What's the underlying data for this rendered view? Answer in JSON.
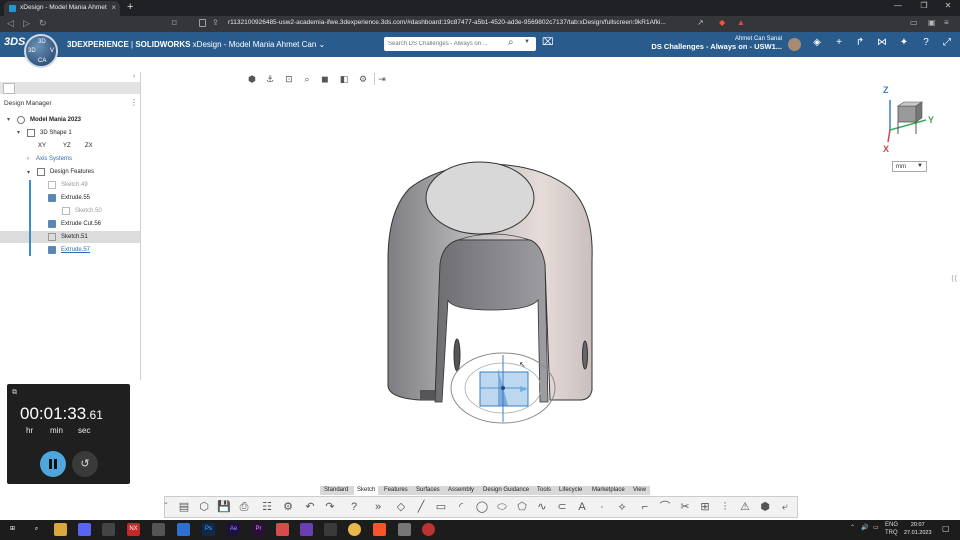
{
  "browser": {
    "tab_title": "xDesign - Model Mania Ahmet Can",
    "tab_close": "×",
    "new_tab": "+",
    "url": "r1132100926485-usw2-academia-ifwe.3dexperience.3ds.com/#dashboard:19c87477-a5b1-4520-ad3e-9569802c7137/tab:xDesign/fullscreen:9kR1Afki..."
  },
  "appbar": {
    "brand": "3DS",
    "compass_top": "3D",
    "compass_left": "3D",
    "compass_right": "V",
    "compass_bottom": "CA",
    "platform": "3DEXPERIENCE",
    "separator": " | ",
    "product": "SOLIDWORKS",
    "app_name": "xDesign",
    "doc_title": "- Model Mania Ahmet Can",
    "search_placeholder": "Search DS Challenges - Always on ...",
    "user_name": "Ahmet Can Sanal",
    "community": "DS Challenges - Always on - USW1..."
  },
  "panel": {
    "heading": "Design Manager",
    "root": "Model Mania 2023",
    "shape": "3D Shape 1",
    "planes": [
      "XY",
      "YZ",
      "ZX"
    ],
    "axis_systems": "Axis Systems",
    "design_features": "Design Features",
    "features": [
      "Sketch.49",
      "Extrude.55",
      "Sketch.50",
      "Extrude Cut.56",
      "Sketch.51",
      "Extrude.57"
    ]
  },
  "stopwatch": {
    "hhmmss": "00:01:33",
    "hundredths": ".61",
    "labels": [
      "hr",
      "min",
      "sec"
    ]
  },
  "viewcube": {
    "z": "Z",
    "y": "Y",
    "x": "X",
    "units": "mm"
  },
  "command_tabs": [
    "Standard",
    "Sketch",
    "Features",
    "Surfaces",
    "Assembly",
    "Design Guidance",
    "Tools",
    "Lifecycle",
    "Marketplace",
    "View"
  ],
  "active_command_tab": "Sketch",
  "taskbar": {
    "lang": "ENG",
    "layout": "TRQ",
    "time": "20:07",
    "date": "27.01.2023"
  }
}
